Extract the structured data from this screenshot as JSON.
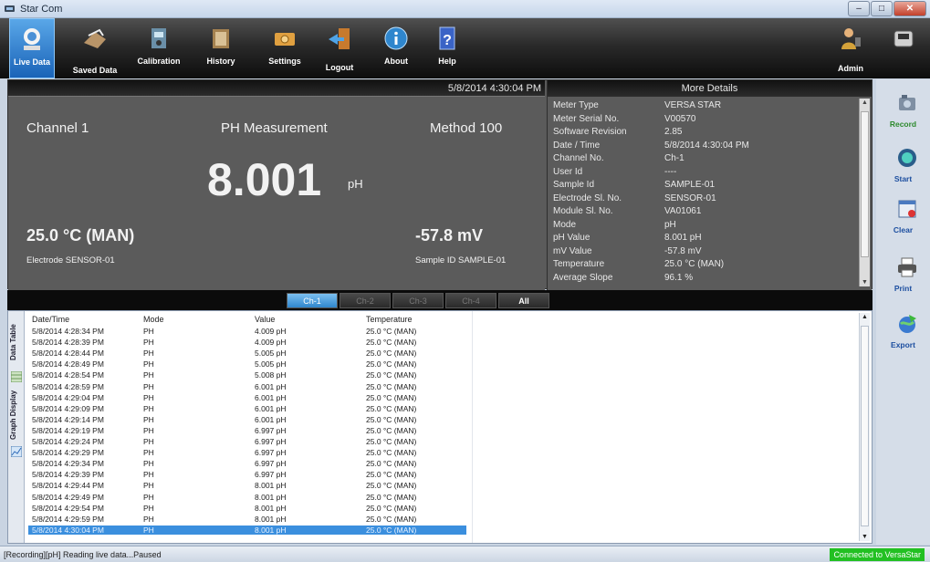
{
  "window": {
    "title": "Star Com"
  },
  "toolbar": {
    "items": [
      {
        "label": "Live Data",
        "icon": "live-data-icon"
      },
      {
        "label": "Saved Data",
        "icon": "saved-data-icon"
      },
      {
        "label": "Calibration",
        "icon": "calibration-icon"
      },
      {
        "label": "History",
        "icon": "history-icon"
      },
      {
        "label": "Settings",
        "icon": "settings-icon"
      },
      {
        "label": "Logout",
        "icon": "logout-icon"
      },
      {
        "label": "About",
        "icon": "about-icon"
      },
      {
        "label": "Help",
        "icon": "help-icon"
      }
    ],
    "admin_label": "Admin"
  },
  "measurement": {
    "datetime": "5/8/2014 4:30:04 PM",
    "channel": "Channel 1",
    "mode_title": "PH Measurement",
    "method": "Method 100",
    "value": "8.001",
    "unit": "pH",
    "temperature": "25.0 °C (MAN)",
    "mv": "-57.8 mV",
    "electrode": "Electrode SENSOR-01",
    "sample": "Sample ID SAMPLE-01"
  },
  "details": {
    "title": "More Details",
    "rows": [
      {
        "k": "Meter Type",
        "v": "VERSA STAR"
      },
      {
        "k": "Meter Serial No.",
        "v": "V00570"
      },
      {
        "k": "Software Revision",
        "v": "2.85"
      },
      {
        "k": "Date / Time",
        "v": "5/8/2014 4:30:04 PM"
      },
      {
        "k": "Channel No.",
        "v": "Ch-1"
      },
      {
        "k": "User Id",
        "v": "----"
      },
      {
        "k": "Sample Id",
        "v": "SAMPLE-01"
      },
      {
        "k": "Electrode Sl. No.",
        "v": "SENSOR-01"
      },
      {
        "k": "Module Sl. No.",
        "v": "VA01061"
      },
      {
        "k": "Mode",
        "v": "pH"
      },
      {
        "k": "pH Value",
        "v": "8.001 pH"
      },
      {
        "k": "mV Value",
        "v": "-57.8 mV"
      },
      {
        "k": "Temperature",
        "v": "25.0 °C (MAN)"
      },
      {
        "k": "Average Slope",
        "v": "96.1 %"
      }
    ]
  },
  "channels": {
    "ch1": "Ch-1",
    "ch2": "Ch-2",
    "ch3": "Ch-3",
    "ch4": "Ch-4",
    "all": "All"
  },
  "tabs": {
    "data_table": "Data Table",
    "graph_display": "Graph Display"
  },
  "table": {
    "headers": [
      "Date/Time",
      "Mode",
      "Value",
      "Temperature"
    ],
    "rows": [
      [
        "5/8/2014 4:28:34 PM",
        "PH",
        "4.009 pH",
        "25.0 °C (MAN)"
      ],
      [
        "5/8/2014 4:28:39 PM",
        "PH",
        "4.009 pH",
        "25.0 °C (MAN)"
      ],
      [
        "5/8/2014 4:28:44 PM",
        "PH",
        "5.005 pH",
        "25.0 °C (MAN)"
      ],
      [
        "5/8/2014 4:28:49 PM",
        "PH",
        "5.005 pH",
        "25.0 °C (MAN)"
      ],
      [
        "5/8/2014 4:28:54 PM",
        "PH",
        "5.008 pH",
        "25.0 °C (MAN)"
      ],
      [
        "5/8/2014 4:28:59 PM",
        "PH",
        "6.001 pH",
        "25.0 °C (MAN)"
      ],
      [
        "5/8/2014 4:29:04 PM",
        "PH",
        "6.001 pH",
        "25.0 °C (MAN)"
      ],
      [
        "5/8/2014 4:29:09 PM",
        "PH",
        "6.001 pH",
        "25.0 °C (MAN)"
      ],
      [
        "5/8/2014 4:29:14 PM",
        "PH",
        "6.001 pH",
        "25.0 °C (MAN)"
      ],
      [
        "5/8/2014 4:29:19 PM",
        "PH",
        "6.997 pH",
        "25.0 °C (MAN)"
      ],
      [
        "5/8/2014 4:29:24 PM",
        "PH",
        "6.997 pH",
        "25.0 °C (MAN)"
      ],
      [
        "5/8/2014 4:29:29 PM",
        "PH",
        "6.997 pH",
        "25.0 °C (MAN)"
      ],
      [
        "5/8/2014 4:29:34 PM",
        "PH",
        "6.997 pH",
        "25.0 °C (MAN)"
      ],
      [
        "5/8/2014 4:29:39 PM",
        "PH",
        "6.997 pH",
        "25.0 °C (MAN)"
      ],
      [
        "5/8/2014 4:29:44 PM",
        "PH",
        "8.001 pH",
        "25.0 °C (MAN)"
      ],
      [
        "5/8/2014 4:29:49 PM",
        "PH",
        "8.001 pH",
        "25.0 °C (MAN)"
      ],
      [
        "5/8/2014 4:29:54 PM",
        "PH",
        "8.001 pH",
        "25.0 °C (MAN)"
      ],
      [
        "5/8/2014 4:29:59 PM",
        "PH",
        "8.001 pH",
        "25.0 °C (MAN)"
      ],
      [
        "5/8/2014 4:30:04 PM",
        "PH",
        "8.001 pH",
        "25.0 °C (MAN)"
      ]
    ]
  },
  "sidebar": {
    "record": "Record",
    "start": "Start",
    "clear": "Clear",
    "print": "Print",
    "export": "Export"
  },
  "status": {
    "text": "[Recording][pH] Reading live data...Paused",
    "connection": "Connected to VersaStar"
  },
  "colors": {
    "accent": "#2f86cd",
    "connected": "#22c022",
    "panel": "#5b5b5b"
  }
}
